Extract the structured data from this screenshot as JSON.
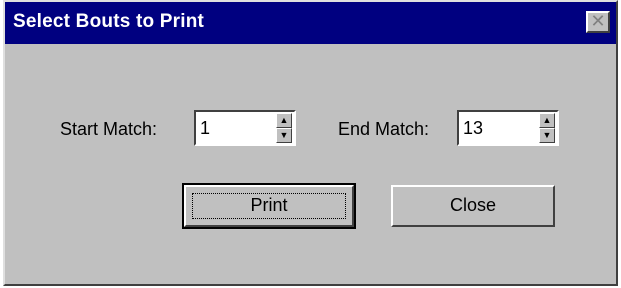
{
  "dialog": {
    "title": "Select Bouts to Print",
    "close_glyph": "✕"
  },
  "start_match": {
    "label": "Start Match:",
    "value": "1"
  },
  "end_match": {
    "label": "End Match:",
    "value": "13"
  },
  "buttons": {
    "print_label": "Print",
    "close_label": "Close"
  },
  "icons": {
    "spin_up": "▲",
    "spin_down": "▼"
  },
  "colors": {
    "titlebar": "#000080",
    "face": "#c0c0c0"
  }
}
